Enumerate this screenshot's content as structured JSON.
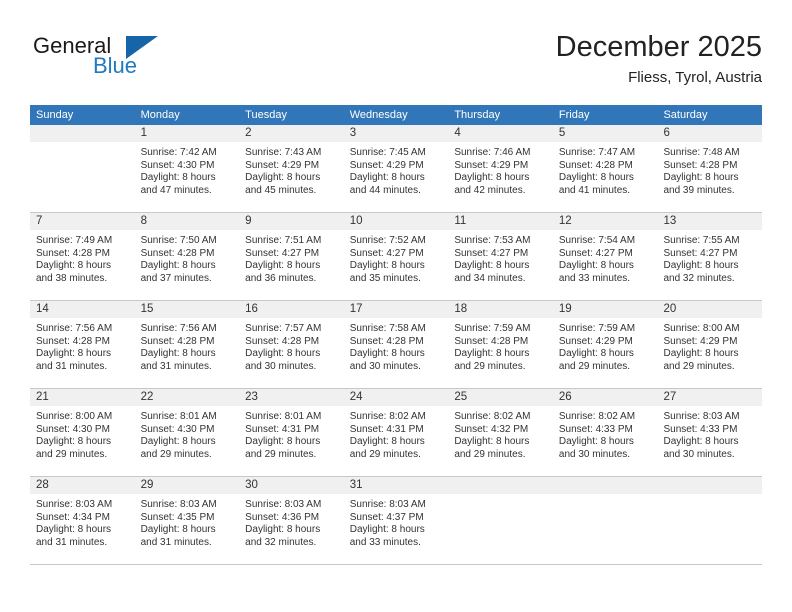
{
  "brand": {
    "name_part1": "General",
    "name_part2": "Blue",
    "triangle_color": "#1565a8",
    "blue_color": "#1f7ac0"
  },
  "header": {
    "month_title": "December 2025",
    "location": "Fliess, Tyrol, Austria"
  },
  "calendar": {
    "header_bg": "#3176b8",
    "day_band_bg": "#f0f0f0",
    "weekdays": [
      "Sunday",
      "Monday",
      "Tuesday",
      "Wednesday",
      "Thursday",
      "Friday",
      "Saturday"
    ],
    "weeks": [
      [
        {
          "day": "",
          "sunrise": "",
          "sunset": "",
          "daylight1": "",
          "daylight2": ""
        },
        {
          "day": "1",
          "sunrise": "Sunrise: 7:42 AM",
          "sunset": "Sunset: 4:30 PM",
          "daylight1": "Daylight: 8 hours",
          "daylight2": "and 47 minutes."
        },
        {
          "day": "2",
          "sunrise": "Sunrise: 7:43 AM",
          "sunset": "Sunset: 4:29 PM",
          "daylight1": "Daylight: 8 hours",
          "daylight2": "and 45 minutes."
        },
        {
          "day": "3",
          "sunrise": "Sunrise: 7:45 AM",
          "sunset": "Sunset: 4:29 PM",
          "daylight1": "Daylight: 8 hours",
          "daylight2": "and 44 minutes."
        },
        {
          "day": "4",
          "sunrise": "Sunrise: 7:46 AM",
          "sunset": "Sunset: 4:29 PM",
          "daylight1": "Daylight: 8 hours",
          "daylight2": "and 42 minutes."
        },
        {
          "day": "5",
          "sunrise": "Sunrise: 7:47 AM",
          "sunset": "Sunset: 4:28 PM",
          "daylight1": "Daylight: 8 hours",
          "daylight2": "and 41 minutes."
        },
        {
          "day": "6",
          "sunrise": "Sunrise: 7:48 AM",
          "sunset": "Sunset: 4:28 PM",
          "daylight1": "Daylight: 8 hours",
          "daylight2": "and 39 minutes."
        }
      ],
      [
        {
          "day": "7",
          "sunrise": "Sunrise: 7:49 AM",
          "sunset": "Sunset: 4:28 PM",
          "daylight1": "Daylight: 8 hours",
          "daylight2": "and 38 minutes."
        },
        {
          "day": "8",
          "sunrise": "Sunrise: 7:50 AM",
          "sunset": "Sunset: 4:28 PM",
          "daylight1": "Daylight: 8 hours",
          "daylight2": "and 37 minutes."
        },
        {
          "day": "9",
          "sunrise": "Sunrise: 7:51 AM",
          "sunset": "Sunset: 4:27 PM",
          "daylight1": "Daylight: 8 hours",
          "daylight2": "and 36 minutes."
        },
        {
          "day": "10",
          "sunrise": "Sunrise: 7:52 AM",
          "sunset": "Sunset: 4:27 PM",
          "daylight1": "Daylight: 8 hours",
          "daylight2": "and 35 minutes."
        },
        {
          "day": "11",
          "sunrise": "Sunrise: 7:53 AM",
          "sunset": "Sunset: 4:27 PM",
          "daylight1": "Daylight: 8 hours",
          "daylight2": "and 34 minutes."
        },
        {
          "day": "12",
          "sunrise": "Sunrise: 7:54 AM",
          "sunset": "Sunset: 4:27 PM",
          "daylight1": "Daylight: 8 hours",
          "daylight2": "and 33 minutes."
        },
        {
          "day": "13",
          "sunrise": "Sunrise: 7:55 AM",
          "sunset": "Sunset: 4:27 PM",
          "daylight1": "Daylight: 8 hours",
          "daylight2": "and 32 minutes."
        }
      ],
      [
        {
          "day": "14",
          "sunrise": "Sunrise: 7:56 AM",
          "sunset": "Sunset: 4:28 PM",
          "daylight1": "Daylight: 8 hours",
          "daylight2": "and 31 minutes."
        },
        {
          "day": "15",
          "sunrise": "Sunrise: 7:56 AM",
          "sunset": "Sunset: 4:28 PM",
          "daylight1": "Daylight: 8 hours",
          "daylight2": "and 31 minutes."
        },
        {
          "day": "16",
          "sunrise": "Sunrise: 7:57 AM",
          "sunset": "Sunset: 4:28 PM",
          "daylight1": "Daylight: 8 hours",
          "daylight2": "and 30 minutes."
        },
        {
          "day": "17",
          "sunrise": "Sunrise: 7:58 AM",
          "sunset": "Sunset: 4:28 PM",
          "daylight1": "Daylight: 8 hours",
          "daylight2": "and 30 minutes."
        },
        {
          "day": "18",
          "sunrise": "Sunrise: 7:59 AM",
          "sunset": "Sunset: 4:28 PM",
          "daylight1": "Daylight: 8 hours",
          "daylight2": "and 29 minutes."
        },
        {
          "day": "19",
          "sunrise": "Sunrise: 7:59 AM",
          "sunset": "Sunset: 4:29 PM",
          "daylight1": "Daylight: 8 hours",
          "daylight2": "and 29 minutes."
        },
        {
          "day": "20",
          "sunrise": "Sunrise: 8:00 AM",
          "sunset": "Sunset: 4:29 PM",
          "daylight1": "Daylight: 8 hours",
          "daylight2": "and 29 minutes."
        }
      ],
      [
        {
          "day": "21",
          "sunrise": "Sunrise: 8:00 AM",
          "sunset": "Sunset: 4:30 PM",
          "daylight1": "Daylight: 8 hours",
          "daylight2": "and 29 minutes."
        },
        {
          "day": "22",
          "sunrise": "Sunrise: 8:01 AM",
          "sunset": "Sunset: 4:30 PM",
          "daylight1": "Daylight: 8 hours",
          "daylight2": "and 29 minutes."
        },
        {
          "day": "23",
          "sunrise": "Sunrise: 8:01 AM",
          "sunset": "Sunset: 4:31 PM",
          "daylight1": "Daylight: 8 hours",
          "daylight2": "and 29 minutes."
        },
        {
          "day": "24",
          "sunrise": "Sunrise: 8:02 AM",
          "sunset": "Sunset: 4:31 PM",
          "daylight1": "Daylight: 8 hours",
          "daylight2": "and 29 minutes."
        },
        {
          "day": "25",
          "sunrise": "Sunrise: 8:02 AM",
          "sunset": "Sunset: 4:32 PM",
          "daylight1": "Daylight: 8 hours",
          "daylight2": "and 29 minutes."
        },
        {
          "day": "26",
          "sunrise": "Sunrise: 8:02 AM",
          "sunset": "Sunset: 4:33 PM",
          "daylight1": "Daylight: 8 hours",
          "daylight2": "and 30 minutes."
        },
        {
          "day": "27",
          "sunrise": "Sunrise: 8:03 AM",
          "sunset": "Sunset: 4:33 PM",
          "daylight1": "Daylight: 8 hours",
          "daylight2": "and 30 minutes."
        }
      ],
      [
        {
          "day": "28",
          "sunrise": "Sunrise: 8:03 AM",
          "sunset": "Sunset: 4:34 PM",
          "daylight1": "Daylight: 8 hours",
          "daylight2": "and 31 minutes."
        },
        {
          "day": "29",
          "sunrise": "Sunrise: 8:03 AM",
          "sunset": "Sunset: 4:35 PM",
          "daylight1": "Daylight: 8 hours",
          "daylight2": "and 31 minutes."
        },
        {
          "day": "30",
          "sunrise": "Sunrise: 8:03 AM",
          "sunset": "Sunset: 4:36 PM",
          "daylight1": "Daylight: 8 hours",
          "daylight2": "and 32 minutes."
        },
        {
          "day": "31",
          "sunrise": "Sunrise: 8:03 AM",
          "sunset": "Sunset: 4:37 PM",
          "daylight1": "Daylight: 8 hours",
          "daylight2": "and 33 minutes."
        },
        {
          "day": "",
          "sunrise": "",
          "sunset": "",
          "daylight1": "",
          "daylight2": ""
        },
        {
          "day": "",
          "sunrise": "",
          "sunset": "",
          "daylight1": "",
          "daylight2": ""
        },
        {
          "day": "",
          "sunrise": "",
          "sunset": "",
          "daylight1": "",
          "daylight2": ""
        }
      ]
    ]
  }
}
